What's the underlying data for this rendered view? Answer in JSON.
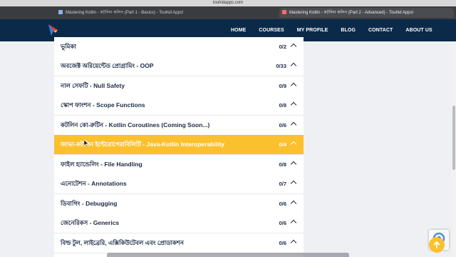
{
  "browser": {
    "url": "touhidapps.com",
    "tabs": [
      {
        "title": "Mastering Kotlin - কটলিন কলিন (Part 1 - Basics) - Touhid Apps!"
      },
      {
        "title": "Mastering Kotlin - কটলিন কলিন (Part 2 - Advanced) - Touhid Apps!"
      }
    ]
  },
  "nav": {
    "items": [
      "HOME",
      "COURSES",
      "MY PROFILE",
      "BLOG",
      "CONTACT",
      "ABOUT US"
    ]
  },
  "colors": {
    "nav_bg": "#0b2a4a",
    "accent": "#fbc02d"
  },
  "sections": [
    {
      "title": "ভূমিকা",
      "count": "0/2"
    },
    {
      "title": "অবজেক্ট অরিয়েন্টেড প্রোগ্রামিং - OOP",
      "count": "0/33"
    },
    {
      "title": "নাল সেফটি - Null Safety",
      "count": "0/9"
    },
    {
      "title": "স্কোপ ফাংশন - Scope Functions",
      "count": "0/8"
    },
    {
      "title": "কটলিন কো-রুটিন - Kotlin Coroutines (Coming Soon...)",
      "count": "0/6"
    },
    {
      "title": "জাভা-কটলিন ইন্টেরোপেরাবিলিটি - Java-Kotlin Interoperability",
      "count": "0/4",
      "active": true
    },
    {
      "title": "ফাইল হ্যান্ডেলিং - File Handling",
      "count": "0/8"
    },
    {
      "title": "এনোটেশন - Annotations",
      "count": "0/7"
    },
    {
      "title": "ডিবাগিং - Debugging",
      "count": "0/6"
    },
    {
      "title": "জেনেরিকস - Generics",
      "count": "0/6"
    },
    {
      "title": "বিল্ড টুল, লাইব্রেরি, এক্সিকিউটেবল এবং প্রোডাকশন",
      "count": "0/6"
    }
  ]
}
